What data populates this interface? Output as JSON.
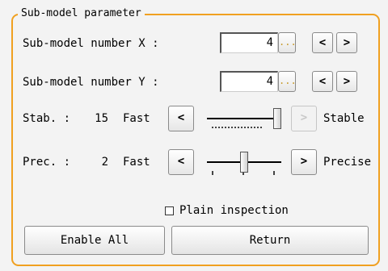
{
  "group_title": "Sub-model parameter",
  "sub_x": {
    "label": "Sub-model number X :",
    "value": "4",
    "more": "...",
    "dec": "<",
    "inc": ">"
  },
  "sub_y": {
    "label": "Sub-model number Y :",
    "value": "4",
    "more": "...",
    "dec": "<",
    "inc": ">"
  },
  "stab": {
    "label": "Stab. :",
    "value": "15",
    "left": "Fast",
    "right": "Stable",
    "dec": "<",
    "inc": ">",
    "level": 1.0
  },
  "prec": {
    "label": "Prec. :",
    "value": "2",
    "left": "Fast",
    "right": "Precise",
    "dec": "<",
    "inc": ">",
    "level": 0.5
  },
  "plain_inspection": {
    "label": "Plain inspection",
    "checked": false
  },
  "buttons": {
    "enable_all": "Enable All",
    "return": "Return"
  }
}
